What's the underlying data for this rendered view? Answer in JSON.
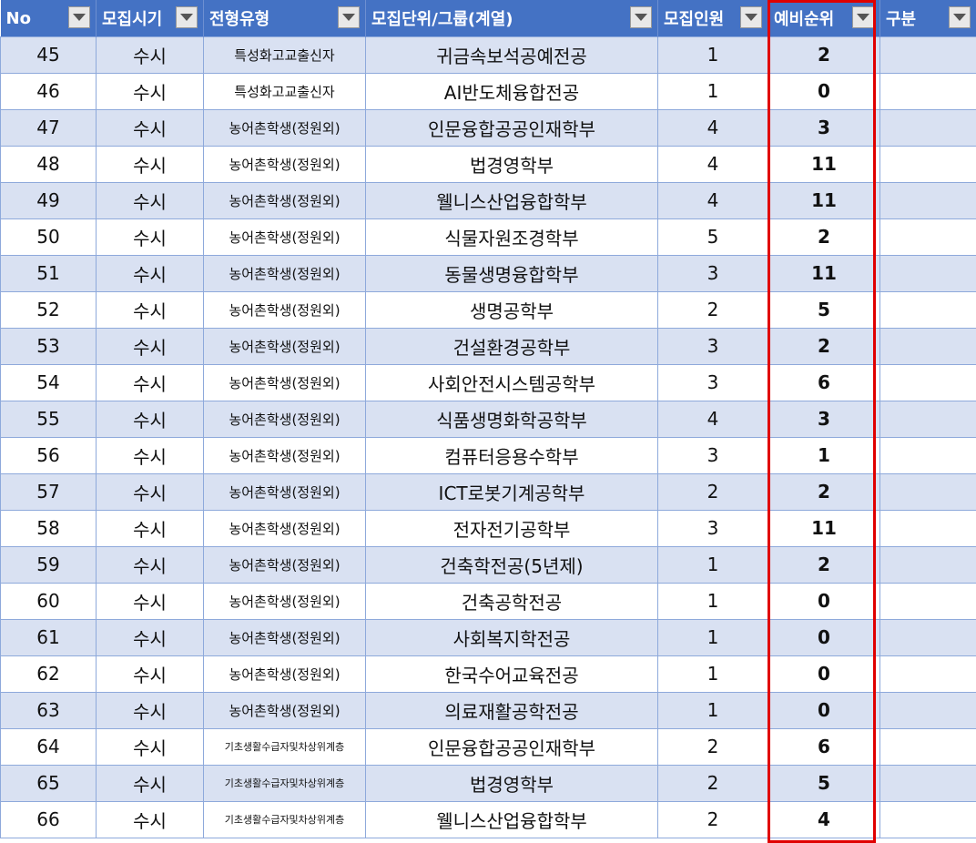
{
  "headers": [
    {
      "label": "No"
    },
    {
      "label": "모집시기"
    },
    {
      "label": "전형유형"
    },
    {
      "label": "모집단위/그룹(계열)"
    },
    {
      "label": "모집인원"
    },
    {
      "label": "예비순위"
    },
    {
      "label": "구분"
    }
  ],
  "rows": [
    {
      "no": "45",
      "period": "수시",
      "type": "특성화고교출신자",
      "unit": "귀금속보석공예전공",
      "count": "1",
      "rank": "2",
      "category": ""
    },
    {
      "no": "46",
      "period": "수시",
      "type": "특성화고교출신자",
      "unit": "AI반도체융합전공",
      "count": "1",
      "rank": "0",
      "category": ""
    },
    {
      "no": "47",
      "period": "수시",
      "type": "농어촌학생(정원외)",
      "unit": "인문융합공공인재학부",
      "count": "4",
      "rank": "3",
      "category": ""
    },
    {
      "no": "48",
      "period": "수시",
      "type": "농어촌학생(정원외)",
      "unit": "법경영학부",
      "count": "4",
      "rank": "11",
      "category": ""
    },
    {
      "no": "49",
      "period": "수시",
      "type": "농어촌학생(정원외)",
      "unit": "웰니스산업융합학부",
      "count": "4",
      "rank": "11",
      "category": ""
    },
    {
      "no": "50",
      "period": "수시",
      "type": "농어촌학생(정원외)",
      "unit": "식물자원조경학부",
      "count": "5",
      "rank": "2",
      "category": ""
    },
    {
      "no": "51",
      "period": "수시",
      "type": "농어촌학생(정원외)",
      "unit": "동물생명융합학부",
      "count": "3",
      "rank": "11",
      "category": ""
    },
    {
      "no": "52",
      "period": "수시",
      "type": "농어촌학생(정원외)",
      "unit": "생명공학부",
      "count": "2",
      "rank": "5",
      "category": ""
    },
    {
      "no": "53",
      "period": "수시",
      "type": "농어촌학생(정원외)",
      "unit": "건설환경공학부",
      "count": "3",
      "rank": "2",
      "category": ""
    },
    {
      "no": "54",
      "period": "수시",
      "type": "농어촌학생(정원외)",
      "unit": "사회안전시스템공학부",
      "count": "3",
      "rank": "6",
      "category": ""
    },
    {
      "no": "55",
      "period": "수시",
      "type": "농어촌학생(정원외)",
      "unit": "식품생명화학공학부",
      "count": "4",
      "rank": "3",
      "category": ""
    },
    {
      "no": "56",
      "period": "수시",
      "type": "농어촌학생(정원외)",
      "unit": "컴퓨터응용수학부",
      "count": "3",
      "rank": "1",
      "category": ""
    },
    {
      "no": "57",
      "period": "수시",
      "type": "농어촌학생(정원외)",
      "unit": "ICT로봇기계공학부",
      "count": "2",
      "rank": "2",
      "category": ""
    },
    {
      "no": "58",
      "period": "수시",
      "type": "농어촌학생(정원외)",
      "unit": "전자전기공학부",
      "count": "3",
      "rank": "11",
      "category": ""
    },
    {
      "no": "59",
      "period": "수시",
      "type": "농어촌학생(정원외)",
      "unit": "건축학전공(5년제)",
      "count": "1",
      "rank": "2",
      "category": ""
    },
    {
      "no": "60",
      "period": "수시",
      "type": "농어촌학생(정원외)",
      "unit": "건축공학전공",
      "count": "1",
      "rank": "0",
      "category": ""
    },
    {
      "no": "61",
      "period": "수시",
      "type": "농어촌학생(정원외)",
      "unit": "사회복지학전공",
      "count": "1",
      "rank": "0",
      "category": ""
    },
    {
      "no": "62",
      "period": "수시",
      "type": "농어촌학생(정원외)",
      "unit": "한국수어교육전공",
      "count": "1",
      "rank": "0",
      "category": ""
    },
    {
      "no": "63",
      "period": "수시",
      "type": "농어촌학생(정원외)",
      "unit": "의료재활공학전공",
      "count": "1",
      "rank": "0",
      "category": ""
    },
    {
      "no": "64",
      "period": "수시",
      "type": "기초생활수급자및차상위계층",
      "unit": "인문융합공공인재학부",
      "count": "2",
      "rank": "6",
      "category": ""
    },
    {
      "no": "65",
      "period": "수시",
      "type": "기초생활수급자및차상위계층",
      "unit": "법경영학부",
      "count": "2",
      "rank": "5",
      "category": ""
    },
    {
      "no": "66",
      "period": "수시",
      "type": "기초생활수급자및차상위계층",
      "unit": "웰니스산업융합학부",
      "count": "2",
      "rank": "4",
      "category": ""
    }
  ],
  "icons": {
    "filter": "dropdown-arrow-icon"
  },
  "colors": {
    "header_bg": "#4472c4",
    "band_bg": "#d9e1f2",
    "highlight": "#e00000"
  }
}
